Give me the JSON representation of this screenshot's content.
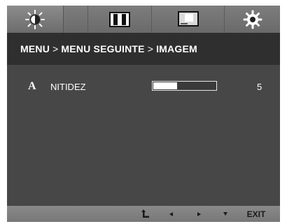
{
  "tabs": [
    {
      "icon": "brightness-sun-icon",
      "active": true
    },
    {
      "icon": "contrast-bars-icon",
      "active": false
    },
    {
      "icon": "picture-screen-icon",
      "active": false
    },
    {
      "icon": "settings-gear-icon",
      "active": false
    }
  ],
  "breadcrumb": {
    "level1": "MENU",
    "separator1": ">",
    "level2": "MENU SEGUINTE",
    "separator2": ">",
    "level3": "IMAGEM"
  },
  "setting": {
    "icon_letter": "A",
    "label": "NITIDEZ",
    "value": "5",
    "level_fraction": 0.38
  },
  "bottom_bar": {
    "buttons": [
      "return-icon",
      "left-arrow-icon",
      "right-arrow-icon",
      "down-arrow-icon"
    ],
    "exit_label": "EXIT"
  },
  "colors": {
    "panel": "#474747",
    "header": "#2f2f2f",
    "tab_strip": "#737373",
    "text": "#ffffff"
  }
}
